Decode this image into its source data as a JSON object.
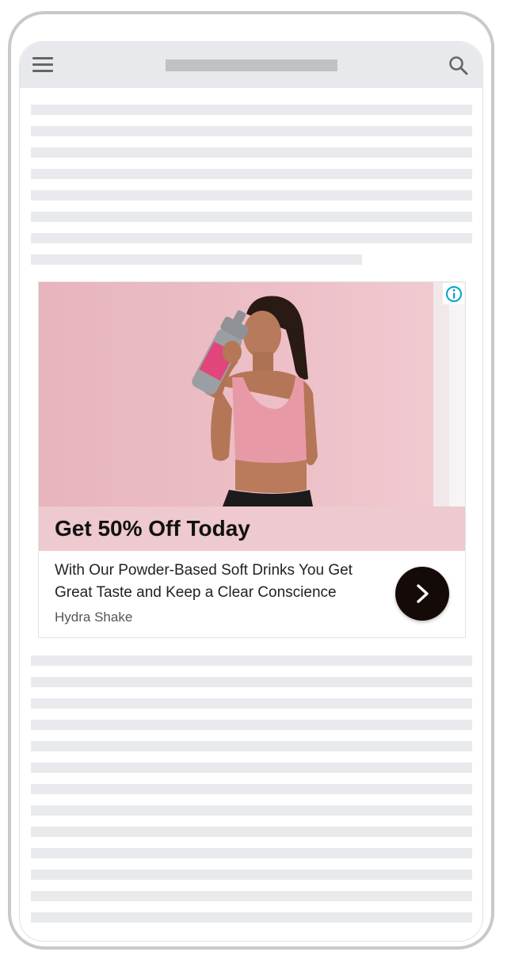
{
  "ad": {
    "headline": "Get 50% Off Today",
    "description": "With Our Powder-Based Soft Drinks You Get Great Taste and Keep a Clear Conscience",
    "brand": "Hydra Shake",
    "accent_color": "#eec9cf",
    "cta_color": "#140b08",
    "info_icon": "info-icon",
    "cta_icon": "chevron-right-icon"
  },
  "topbar": {
    "menu_icon": "hamburger-menu-icon",
    "search_icon": "search-icon"
  }
}
